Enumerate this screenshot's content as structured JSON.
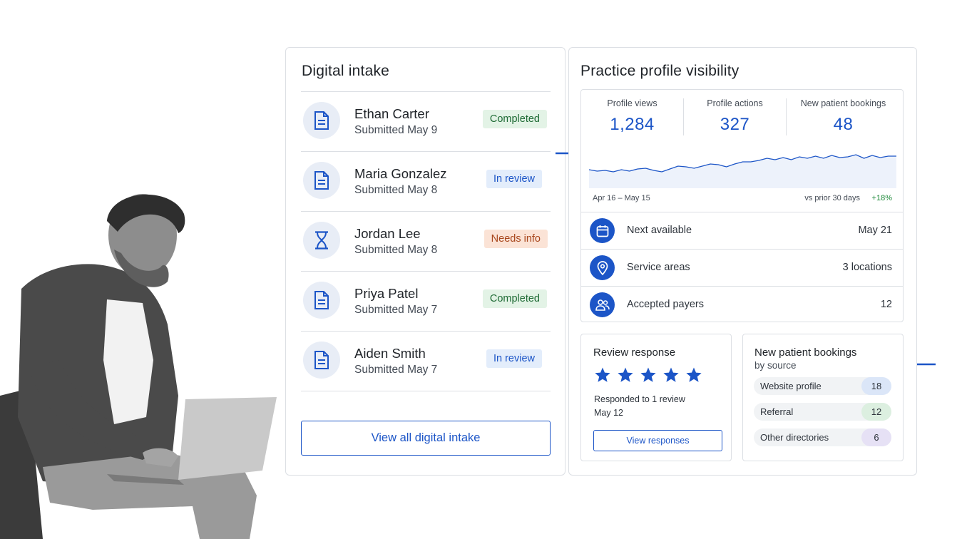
{
  "intake": {
    "title": "Digital intake",
    "items": [
      {
        "name": "Ethan Carter",
        "submitted": "Submitted May 9",
        "status": "Completed",
        "icon": "document-icon"
      },
      {
        "name": "Maria Gonzalez",
        "submitted": "Submitted May 8",
        "status": "In review",
        "icon": "document-icon"
      },
      {
        "name": "Jordan Lee",
        "submitted": "Submitted May 8",
        "status": "Needs info",
        "icon": "hourglass-icon"
      },
      {
        "name": "Priya Patel",
        "submitted": "Submitted May 7",
        "status": "Completed",
        "icon": "document-icon"
      },
      {
        "name": "Aiden Smith",
        "submitted": "Submitted May 7",
        "status": "In review",
        "icon": "document-icon"
      }
    ],
    "view_all_label": "View all digital intake"
  },
  "visibility": {
    "title": "Practice profile visibility",
    "stats": [
      {
        "label": "Profile views",
        "value": "1,284"
      },
      {
        "label": "Profile actions",
        "value": "327"
      },
      {
        "label": "New patient bookings",
        "value": "48"
      }
    ],
    "date_range": "Apr 16 – May 15",
    "comparison": "vs prior 30 days",
    "change": "+18%",
    "details": [
      {
        "icon": "calendar-icon",
        "label": "Next available",
        "value": "May 21"
      },
      {
        "icon": "location-pin-icon",
        "label": "Service areas",
        "value": "3 locations"
      },
      {
        "icon": "people-icon",
        "label": "Accepted payers",
        "value": "12"
      }
    ]
  },
  "review": {
    "title": "Review response",
    "stars": 5,
    "text": "Responded to 1 review",
    "date": "May 12",
    "button_label": "View responses"
  },
  "bookings": {
    "title": "New patient bookings",
    "subtitle": "by source",
    "sources": [
      {
        "label": "Website profile",
        "count": "18",
        "color": "#dbe6f8"
      },
      {
        "label": "Referral",
        "count": "12",
        "color": "#dcefe0"
      },
      {
        "label": "Other directories",
        "count": "6",
        "color": "#e6e1f5"
      }
    ]
  },
  "colors": {
    "accent": "#1c55c7",
    "completed_bg": "#e3f3e6",
    "review_bg": "#e3edfb",
    "needs_info_bg": "#fbe3d6",
    "positive_change": "#1f8a3b"
  },
  "chart_data": {
    "type": "area",
    "series": [
      {
        "values": [
          38,
          40,
          39,
          41,
          38,
          40,
          37,
          36,
          39,
          41,
          37,
          33,
          34,
          36,
          33,
          30,
          31,
          34,
          30,
          27,
          27,
          25,
          22,
          24,
          21,
          24,
          20,
          22,
          19,
          22,
          18,
          21,
          20,
          17,
          22,
          18,
          21,
          19,
          19
        ]
      }
    ],
    "grid": false
  }
}
